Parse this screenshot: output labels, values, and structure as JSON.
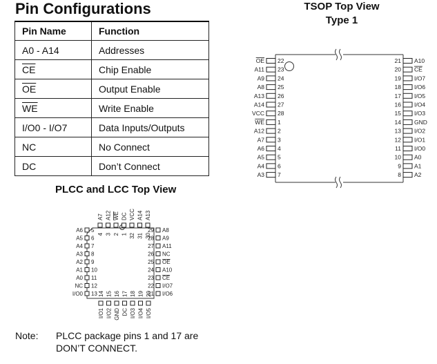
{
  "title": "Pin Configurations",
  "pin_table": {
    "headers": [
      "Pin Name",
      "Function"
    ],
    "rows": [
      {
        "pin": "A0 - A14",
        "function": "Addresses",
        "overline": false
      },
      {
        "pin": "CE",
        "function": "Chip Enable",
        "overline": true
      },
      {
        "pin": "OE",
        "function": "Output Enable",
        "overline": true
      },
      {
        "pin": "WE",
        "function": "Write Enable",
        "overline": true
      },
      {
        "pin": "I/O0 - I/O7",
        "function": "Data Inputs/Outputs",
        "overline": false
      },
      {
        "pin": "NC",
        "function": "No Connect",
        "overline": false
      },
      {
        "pin": "DC",
        "function": "Don’t Connect",
        "overline": false
      }
    ]
  },
  "plcc": {
    "title": "PLCC and LCC Top View",
    "top": [
      {
        "num": "4",
        "name": "A7"
      },
      {
        "num": "3",
        "name": "A12"
      },
      {
        "num": "2",
        "name": "WE",
        "overline": true
      },
      {
        "num": "1",
        "name": "DC"
      },
      {
        "num": "32",
        "name": "VCC"
      },
      {
        "num": "31",
        "name": "A14"
      },
      {
        "num": "30",
        "name": "A13"
      }
    ],
    "left": [
      {
        "num": "5",
        "name": "A6"
      },
      {
        "num": "6",
        "name": "A5"
      },
      {
        "num": "7",
        "name": "A4"
      },
      {
        "num": "8",
        "name": "A3"
      },
      {
        "num": "9",
        "name": "A2"
      },
      {
        "num": "10",
        "name": "A1"
      },
      {
        "num": "11",
        "name": "A0"
      },
      {
        "num": "12",
        "name": "NC"
      },
      {
        "num": "13",
        "name": "I/O0"
      }
    ],
    "right": [
      {
        "num": "29",
        "name": "A8"
      },
      {
        "num": "28",
        "name": "A9"
      },
      {
        "num": "27",
        "name": "A11"
      },
      {
        "num": "26",
        "name": "NC"
      },
      {
        "num": "25",
        "name": "OE",
        "overline": true
      },
      {
        "num": "24",
        "name": "A10"
      },
      {
        "num": "23",
        "name": "CE",
        "overline": true
      },
      {
        "num": "22",
        "name": "I/O7"
      },
      {
        "num": "21",
        "name": "I/O6"
      }
    ],
    "bottom": [
      {
        "num": "14",
        "name": "I/O1"
      },
      {
        "num": "15",
        "name": "I/O2"
      },
      {
        "num": "16",
        "name": "GND"
      },
      {
        "num": "17",
        "name": "DC"
      },
      {
        "num": "18",
        "name": "I/O3"
      },
      {
        "num": "19",
        "name": "I/O4"
      },
      {
        "num": "20",
        "name": "I/O5"
      }
    ]
  },
  "tsop": {
    "title_line1": "TSOP Top View",
    "title_line2": "Type 1",
    "left": [
      {
        "num": "22",
        "name": "OE",
        "overline": true
      },
      {
        "num": "23",
        "name": "A11"
      },
      {
        "num": "24",
        "name": "A9"
      },
      {
        "num": "25",
        "name": "A8"
      },
      {
        "num": "26",
        "name": "A13"
      },
      {
        "num": "27",
        "name": "A14"
      },
      {
        "num": "28",
        "name": "VCC"
      },
      {
        "num": "1",
        "name": "WE",
        "overline": true
      },
      {
        "num": "2",
        "name": "A12"
      },
      {
        "num": "3",
        "name": "A7"
      },
      {
        "num": "4",
        "name": "A6"
      },
      {
        "num": "5",
        "name": "A5"
      },
      {
        "num": "6",
        "name": "A4"
      },
      {
        "num": "7",
        "name": "A3"
      }
    ],
    "right": [
      {
        "num": "21",
        "name": "A10"
      },
      {
        "num": "20",
        "name": "CE",
        "overline": true
      },
      {
        "num": "19",
        "name": "I/O7"
      },
      {
        "num": "18",
        "name": "I/O6"
      },
      {
        "num": "17",
        "name": "I/O5"
      },
      {
        "num": "16",
        "name": "I/O4"
      },
      {
        "num": "15",
        "name": "I/O3"
      },
      {
        "num": "14",
        "name": "GND"
      },
      {
        "num": "13",
        "name": "I/O2"
      },
      {
        "num": "12",
        "name": "I/O1"
      },
      {
        "num": "11",
        "name": "I/O0"
      },
      {
        "num": "10",
        "name": "A0"
      },
      {
        "num": "9",
        "name": "A1"
      },
      {
        "num": "8",
        "name": "A2"
      }
    ]
  },
  "note": {
    "label": "Note:",
    "text_line1": "PLCC package pins 1 and 17 are",
    "text_line2": "DON’T CONNECT."
  }
}
